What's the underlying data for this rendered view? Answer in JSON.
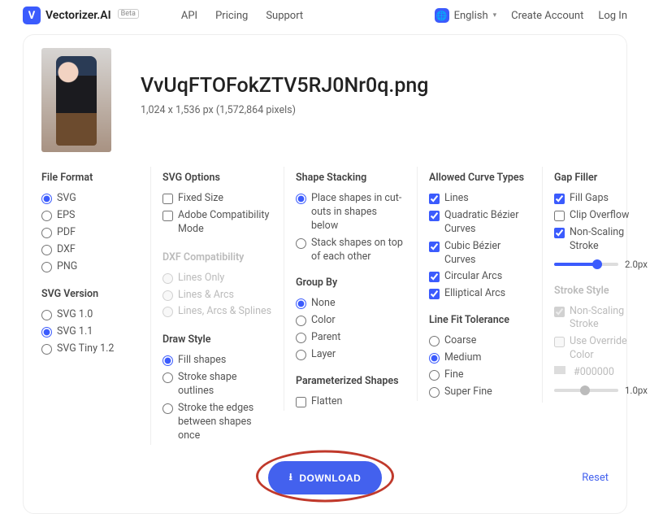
{
  "header": {
    "brand": "Vectorizer.AI",
    "beta": "Beta",
    "nav": {
      "api": "API",
      "pricing": "Pricing",
      "support": "Support"
    },
    "language": "English",
    "create_account": "Create Account",
    "login": "Log In"
  },
  "file": {
    "name": "VvUqFTOFokZTV5RJ0Nr0q.png",
    "dims": "1,024 x 1,536 px (1,572,864 pixels)"
  },
  "sections": {
    "file_format": "File Format",
    "svg_version": "SVG Version",
    "svg_options": "SVG Options",
    "dxf_compat": "DXF Compatibility",
    "draw_style": "Draw Style",
    "shape_stacking": "Shape Stacking",
    "group_by": "Group By",
    "param_shapes": "Parameterized Shapes",
    "allowed_curves": "Allowed Curve Types",
    "line_fit": "Line Fit Tolerance",
    "gap_filler": "Gap Filler",
    "stroke_style": "Stroke Style"
  },
  "file_format": [
    "SVG",
    "EPS",
    "PDF",
    "DXF",
    "PNG"
  ],
  "svg_version": [
    "SVG 1.0",
    "SVG 1.1",
    "SVG Tiny 1.2"
  ],
  "svg_options": {
    "fixed_size": "Fixed Size",
    "adobe": "Adobe Compatibility Mode"
  },
  "dxf_compat": [
    "Lines Only",
    "Lines & Arcs",
    "Lines, Arcs & Splines"
  ],
  "draw_style": {
    "fill": "Fill shapes",
    "stroke_outline": "Stroke shape outlines",
    "stroke_edges": "Stroke the edges between shapes once"
  },
  "shape_stacking": {
    "cutouts": "Place shapes in cut-outs in shapes below",
    "stack": "Stack shapes on top of each other"
  },
  "group_by": [
    "None",
    "Color",
    "Parent",
    "Layer"
  ],
  "param_shapes": {
    "flatten": "Flatten"
  },
  "allowed_curves": [
    "Lines",
    "Quadratic Bézier Curves",
    "Cubic Bézier Curves",
    "Circular Arcs",
    "Elliptical Arcs"
  ],
  "line_fit": [
    "Coarse",
    "Medium",
    "Fine",
    "Super Fine"
  ],
  "gap_filler": {
    "fill_gaps": "Fill Gaps",
    "clip_overflow": "Clip Overflow",
    "non_scaling": "Non-Scaling Stroke",
    "value": "2.0px"
  },
  "stroke_style": {
    "non_scaling": "Non-Scaling Stroke",
    "override": "Use Override Color",
    "color": "#000000",
    "value": "1.0px"
  },
  "actions": {
    "download": "DOWNLOAD",
    "reset": "Reset"
  }
}
